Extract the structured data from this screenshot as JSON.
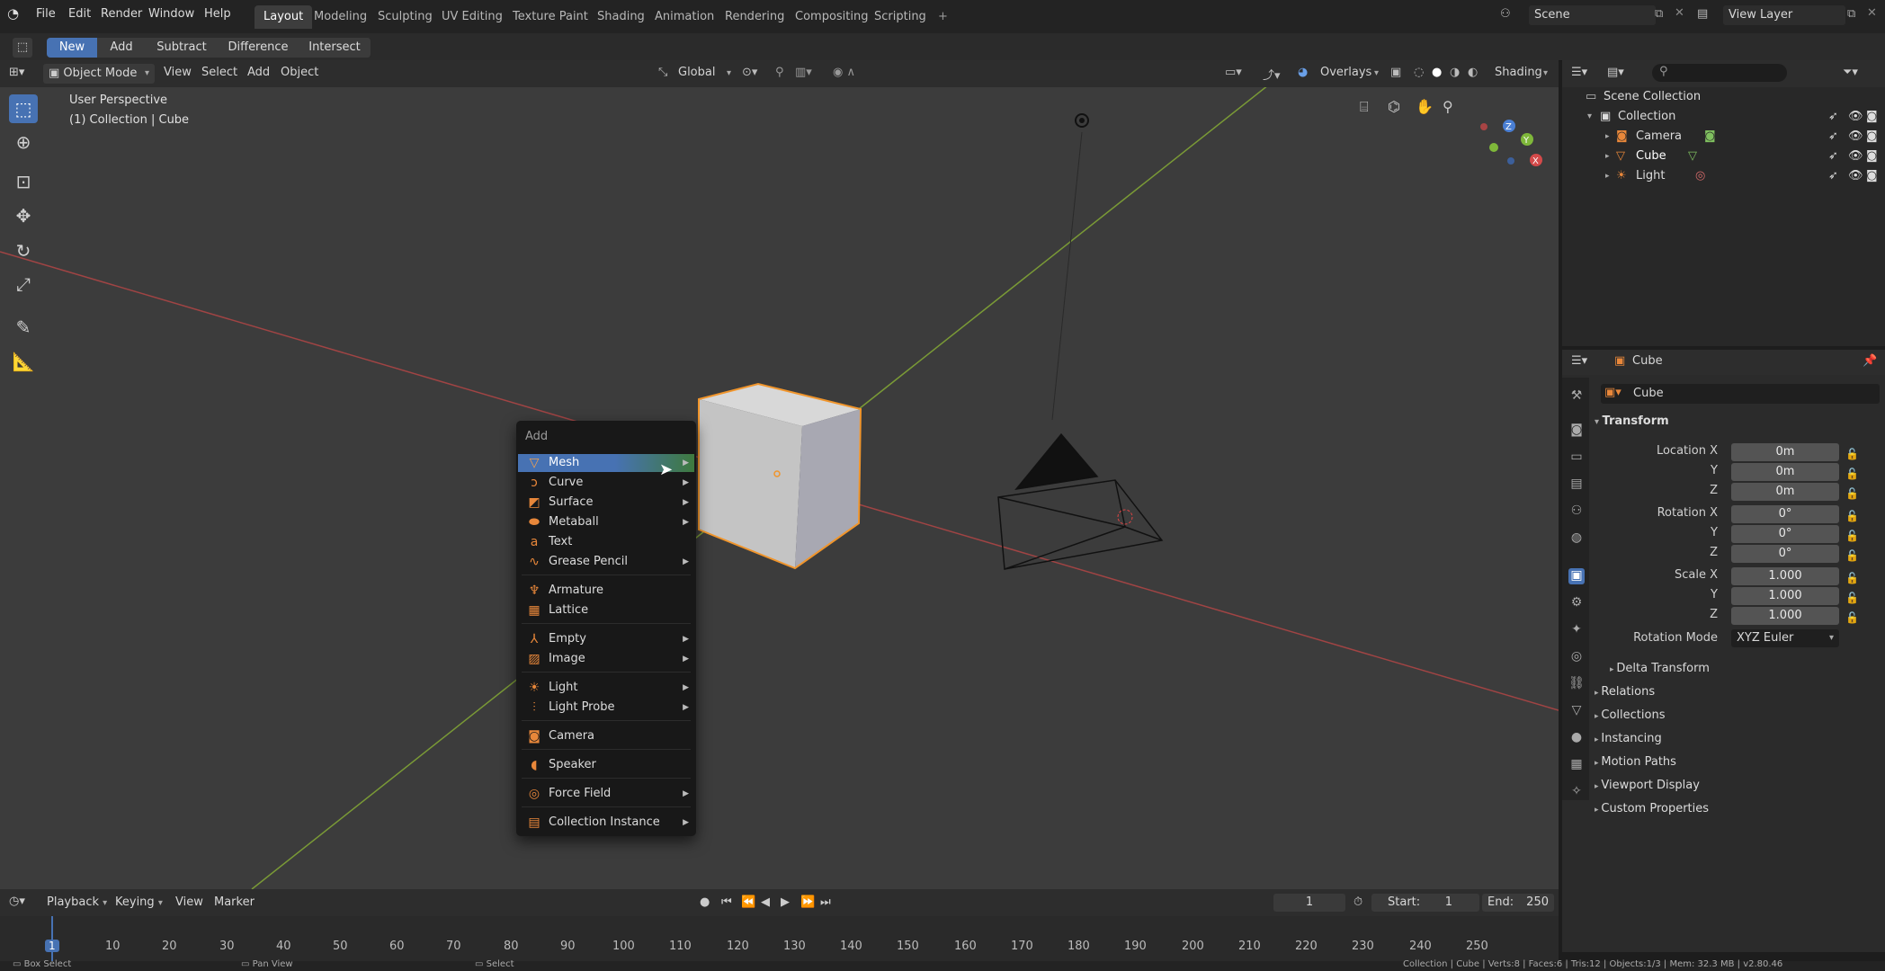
{
  "top_menu": [
    "File",
    "Edit",
    "Render",
    "Window",
    "Help"
  ],
  "workspace_tabs": [
    "Layout",
    "Modeling",
    "Sculpting",
    "UV Editing",
    "Texture Paint",
    "Shading",
    "Animation",
    "Rendering",
    "Compositing",
    "Scripting"
  ],
  "active_workspace": "Layout",
  "scene_name": "Scene",
  "view_layer_name": "View Layer",
  "boolean_buttons": [
    "New",
    "Add",
    "Subtract",
    "Difference",
    "Intersect"
  ],
  "viewport_header": {
    "mode": "Object Mode",
    "menus": [
      "View",
      "Select",
      "Add",
      "Object"
    ],
    "orientation": "Global",
    "overlays_label": "Overlays",
    "shading_label": "Shading"
  },
  "viewport_info": {
    "perspective": "User Perspective",
    "collection": "(1) Collection | Cube"
  },
  "add_menu": {
    "title": "Add",
    "items": [
      {
        "label": "Mesh",
        "icon": "mesh-icon",
        "submenu": true
      },
      {
        "label": "Curve",
        "icon": "curve-icon",
        "submenu": true
      },
      {
        "label": "Surface",
        "icon": "surface-icon",
        "submenu": true
      },
      {
        "label": "Metaball",
        "icon": "metaball-icon",
        "submenu": true
      },
      {
        "label": "Text",
        "icon": "text-icon",
        "submenu": false
      },
      {
        "label": "Grease Pencil",
        "icon": "grease-pencil-icon",
        "submenu": true
      },
      {
        "label": "Armature",
        "icon": "armature-icon",
        "submenu": false
      },
      {
        "label": "Lattice",
        "icon": "lattice-icon",
        "submenu": false
      },
      {
        "label": "Empty",
        "icon": "empty-icon",
        "submenu": true
      },
      {
        "label": "Image",
        "icon": "image-icon",
        "submenu": true
      },
      {
        "label": "Light",
        "icon": "light-icon",
        "submenu": true
      },
      {
        "label": "Light Probe",
        "icon": "light-probe-icon",
        "submenu": true
      },
      {
        "label": "Camera",
        "icon": "camera-icon",
        "submenu": false
      },
      {
        "label": "Speaker",
        "icon": "speaker-icon",
        "submenu": false
      },
      {
        "label": "Force Field",
        "icon": "force-field-icon",
        "submenu": true
      },
      {
        "label": "Collection Instance",
        "icon": "collection-instance-icon",
        "submenu": true
      }
    ]
  },
  "outliner": {
    "root": "Scene Collection",
    "collection": "Collection",
    "objects": [
      "Camera",
      "Cube",
      "Light"
    ]
  },
  "properties": {
    "header_object": "Cube",
    "object_name": "Cube",
    "transform_title": "Transform",
    "location_label": "Location X",
    "rotation_label": "Rotation X",
    "scale_label": "Scale X",
    "y_label": "Y",
    "z_label": "Z",
    "location": [
      "0m",
      "0m",
      "0m"
    ],
    "rotation": [
      "0°",
      "0°",
      "0°"
    ],
    "scale": [
      "1.000",
      "1.000",
      "1.000"
    ],
    "rotation_mode_label": "Rotation Mode",
    "rotation_mode": "XYZ Euler",
    "delta_transform": "Delta Transform",
    "panels": [
      "Relations",
      "Collections",
      "Instancing",
      "Motion Paths",
      "Viewport Display",
      "Custom Properties"
    ]
  },
  "timeline": {
    "menus": [
      "Playback",
      "Keying",
      "View",
      "Marker"
    ],
    "current_frame": "1",
    "start_label": "Start:",
    "start": "1",
    "end_label": "End:",
    "end": "250",
    "ticks": [
      "1",
      "10",
      "20",
      "30",
      "40",
      "50",
      "60",
      "70",
      "80",
      "90",
      "100",
      "110",
      "120",
      "130",
      "140",
      "150",
      "160",
      "170",
      "180",
      "190",
      "200",
      "210",
      "220",
      "230",
      "240",
      "250"
    ]
  },
  "statusbar": {
    "left": "Box Select",
    "middle": "Pan View",
    "right_action": "Select",
    "stats": "Collection | Cube | Verts:8 | Faces:6 | Tris:12 | Objects:1/3 | Mem: 32.3 MB | v2.80.46"
  },
  "colors": {
    "accent": "#4772b3",
    "selected_outline": "#f0952c",
    "x_axis": "#d54a4a",
    "y_axis": "#8ab83a"
  }
}
